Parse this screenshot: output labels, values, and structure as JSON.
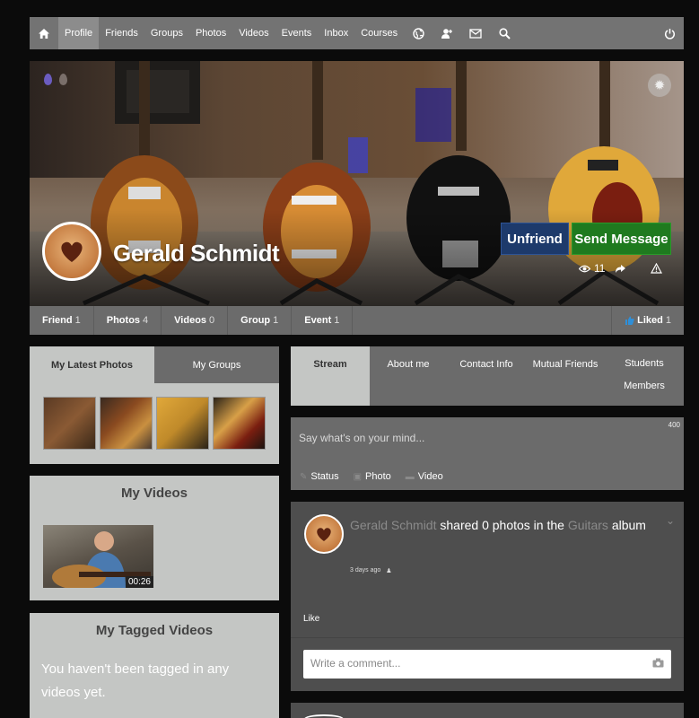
{
  "nav": {
    "items": [
      {
        "label": "Profile",
        "active": true
      },
      {
        "label": "Friends"
      },
      {
        "label": "Groups"
      },
      {
        "label": "Photos"
      },
      {
        "label": "Videos"
      },
      {
        "label": "Events"
      },
      {
        "label": "Inbox"
      },
      {
        "label": "Courses"
      }
    ],
    "icons": [
      "home-icon",
      "globe-icon",
      "friend-request-icon",
      "envelope-icon",
      "search-icon",
      "power-icon"
    ]
  },
  "cover": {
    "name": "Gerald Schmidt",
    "unfriend_label": "Unfriend",
    "message_label": "Send Message",
    "views": "11",
    "colors": {
      "unfriend": "#1d3a6b",
      "message": "#1f7a1f",
      "drop1": "#6b5cc0",
      "drop2": "#7a6f6a"
    }
  },
  "profile_tabs": [
    {
      "label": "Friend",
      "count": "1"
    },
    {
      "label": "Photos",
      "count": "4"
    },
    {
      "label": "Videos",
      "count": "0"
    },
    {
      "label": "Group",
      "count": "1"
    },
    {
      "label": "Event",
      "count": "1"
    }
  ],
  "liked": {
    "label": "Liked",
    "count": "1"
  },
  "sidebar": {
    "tabs": [
      {
        "label": "My Latest Photos",
        "active": true
      },
      {
        "label": "My Groups"
      }
    ],
    "videos_title": "My Videos",
    "video_duration": "00:26",
    "tagged_title": "My Tagged Videos",
    "tagged_message": "You haven't been tagged in any videos yet."
  },
  "stream_tabs": [
    {
      "label": "Stream",
      "active": true
    },
    {
      "label": "About me"
    },
    {
      "label": "Contact Info"
    },
    {
      "label": "Mutual Friends"
    },
    {
      "label": "Students Members"
    }
  ],
  "composer": {
    "counter": "400",
    "placeholder": "Say what's on your mind...",
    "actions": {
      "status": "Status",
      "photo": "Photo",
      "video": "Video"
    }
  },
  "post": {
    "author": "Gerald Schmidt",
    "action": " shared 0 photos in the ",
    "album": "Guitars",
    "album_suffix": " album",
    "time": "3 days ago",
    "like_label": "Like",
    "comment_placeholder": "Write a comment..."
  }
}
